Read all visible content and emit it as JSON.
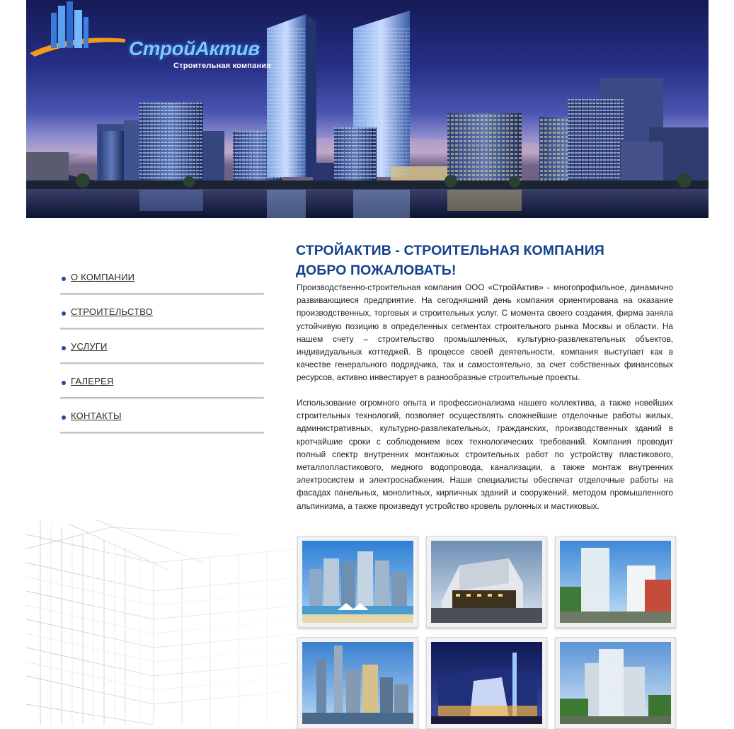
{
  "header": {
    "logo_text": "СтройАктив",
    "logo_subtitle": "Строительная компания"
  },
  "nav": {
    "items": [
      {
        "label": "О КОМПАНИИ"
      },
      {
        "label": "СТРОИТЕЛЬСТВО"
      },
      {
        "label": "УСЛУГИ"
      },
      {
        "label": "ГАЛЕРЕЯ"
      },
      {
        "label": "КОНТАКТЫ"
      }
    ]
  },
  "main": {
    "title_line1": "СТРОЙАКТИВ - СТРОИТЕЛЬНАЯ КОМПАНИЯ",
    "title_line2": "ДОБРО ПОЖАЛОВАТЬ!",
    "paragraph1": "Производственно-строительная компания ООО «СтройАктив» -  многопрофильное, динамично развивающиеся предприятие. На сегодняшний день компания ориентирована на оказание производственных, торговых и строительных услуг. С момента своего создания, фирма заняла устойчивую позицию в определенных сегментах строительного рынка Москвы и области. На нашем счету – строительство промышленных, культурно-развлекательных объектов, индивидуальных коттеджей. В процессе своей деятельности, компания выступает как в качестве генерального подрядчика, так и самостоятельно, за счет собственных финансовых ресурсов, активно инвестирует в разнообразные строительные проекты.",
    "paragraph2": "Использование огромного опыта и профессионализма нашего коллектива, а также новейших строительных технологий, позволяет осуществлять сложнейшие  отделочные работы жилых, административных, культурно-развлекательных, гражданских, производственных зданий в кротчайшие сроки с соблюдением всех  технологических требований. Компания проводит полный спектр внутренних монтажных строительных работ по устройству пластикового,  металлопластикового, медного водопровода, канализации, а также монтаж внутренних электросистем и электроснабжения. Наши специалисты обеспечат  отделочные работы на фасадах панельных, монолитных, кирпичных зданий и сооружений, методом промышленного альпинизма, а также произведут  устройство кровель рулонных и мастиковых."
  },
  "gallery": {
    "items": [
      {
        "name": "gallery-thumb-1",
        "sky": "#2f7fd6",
        "sky2": "#a7d2f5"
      },
      {
        "name": "gallery-thumb-2",
        "sky": "#6e8fb4",
        "sky2": "#d9e4ee"
      },
      {
        "name": "gallery-thumb-3",
        "sky": "#3e89d8",
        "sky2": "#c4e0f7"
      },
      {
        "name": "gallery-thumb-4",
        "sky": "#3b7fd0",
        "sky2": "#b6d8f6"
      },
      {
        "name": "gallery-thumb-5",
        "sky": "#0e1a55",
        "sky2": "#3a4ba5"
      },
      {
        "name": "gallery-thumb-6",
        "sky": "#5b94d6",
        "sky2": "#d8e9f8"
      }
    ]
  },
  "colors": {
    "title": "#13418c",
    "bullet": "#1d4f9c",
    "text": "#222222"
  }
}
